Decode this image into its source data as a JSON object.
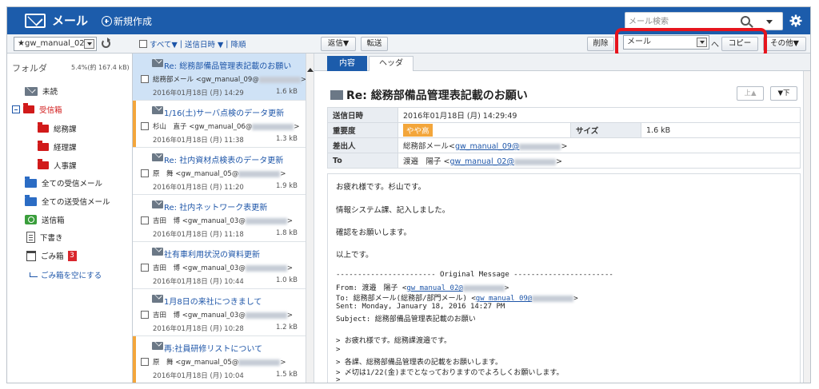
{
  "header": {
    "app_title": "メール",
    "new_message": "新規作成",
    "search_placeholder": "メール検索"
  },
  "toolbar": {
    "account": "★gw_manual_02",
    "select_all": "すべて▼",
    "sort": "送信日時 ▼",
    "sort_desc": "降順",
    "reply": "返信▼",
    "forward": "転送",
    "delete": "削除",
    "move_target": "メール",
    "to_label": "へ",
    "copy": "コピー",
    "other": "その他▼"
  },
  "folders": {
    "heading": "フォルダ",
    "quota": "5.4%(約 167.4 kB)",
    "items": [
      {
        "label": "未読"
      },
      {
        "label": "受信箱"
      },
      {
        "label": "総務課"
      },
      {
        "label": "経理課"
      },
      {
        "label": "人事課"
      },
      {
        "label": "全ての受信メール"
      },
      {
        "label": "全ての送受信メール"
      },
      {
        "label": "送信箱"
      },
      {
        "label": "下書き"
      },
      {
        "label": "ごみ箱",
        "badge": "3"
      },
      {
        "label": "ごみ箱を空にする"
      }
    ]
  },
  "messages": [
    {
      "subject": "Re: 総務部備品管理表記載のお願い",
      "from": "総務部メール <gw_manual_09@",
      "date": "2016年01月18日 (月) 14:29",
      "size": "1.6 kB"
    },
    {
      "subject": "1/16(土)サーバ点検のデータ更新",
      "from": "杉山　直子 <gw_manual_06@",
      "date": "2016年01月18日 (月) 11:38",
      "size": "1.3 kB"
    },
    {
      "subject": "Re: 社内資材点検表のデータ更新",
      "from": "原　舞 <gw_manual_05@",
      "date": "2016年01月18日 (月) 11:20",
      "size": "1.9 kB"
    },
    {
      "subject": "Re: 社内ネットワーク表更新",
      "from": "吉田　博 <gw_manual_03@",
      "date": "2016年01月18日 (月) 11:18",
      "size": "1.8 kB"
    },
    {
      "subject": "社有車利用状況の資料更新",
      "from": "吉田　博 <gw_manual_03@",
      "date": "2016年01月18日 (月) 10:44",
      "size": "1.0 kB"
    },
    {
      "subject": "1月8日の来社につきまして",
      "from": "吉田　博 <gw_manual_03@",
      "date": "2016年01月18日 (月) 10:28",
      "size": "1.2 kB"
    },
    {
      "subject": "再:社員研修リストについて",
      "from": "原　舞 <gw_manual_05@",
      "date": "2016年01月18日 (月) 10:04",
      "size": "1.5 kB"
    }
  ],
  "reader": {
    "tab_content": "内容",
    "tab_header": "ヘッダ",
    "subject": "Re: 総務部備品管理表記載のお願い",
    "prev": "上▲",
    "next": "▼下",
    "k_sent": "送信日時",
    "v_sent": "2016年01月18日 (月) 14:29:49",
    "k_priority": "重要度",
    "v_priority": "やや高",
    "k_size": "サイズ",
    "v_size": "1.6 kB",
    "k_from": "差出人",
    "v_from_name": "総務部メール",
    "v_from_addr": "gw_manual_09@",
    "k_to": "To",
    "v_to_name": "渡邉　陽子",
    "v_to_addr": "gw_manual_02@",
    "body": {
      "l1": "お疲れ様です。杉山です。",
      "l2": "情報システム課、記入しました。",
      "l3": "確認をお願いします。",
      "l4": "以上です。",
      "q1": "----------------------- Original Message -----------------------",
      "q2a": "From: 渡邉　陽子 <",
      "q2b": "gw_manual_02@",
      "q3a": "To: 総務部メール(総務部/部門メール) <",
      "q3b": "gw_manual_09@",
      "q4": "Sent: Monday, January 18, 2016 14:27 PM",
      "q5": "Subject: 総務部備品管理表記載のお願い",
      "r1": "> お疲れ様です。総務課渡邉です。",
      "r2": ">",
      "r3": "> 各課、総務部備品管理表の記載をお願いします。",
      "r4": "> 〆切は1/22(金)までとなっておりますのでよろしくお願いします。",
      "r5": ">"
    }
  }
}
